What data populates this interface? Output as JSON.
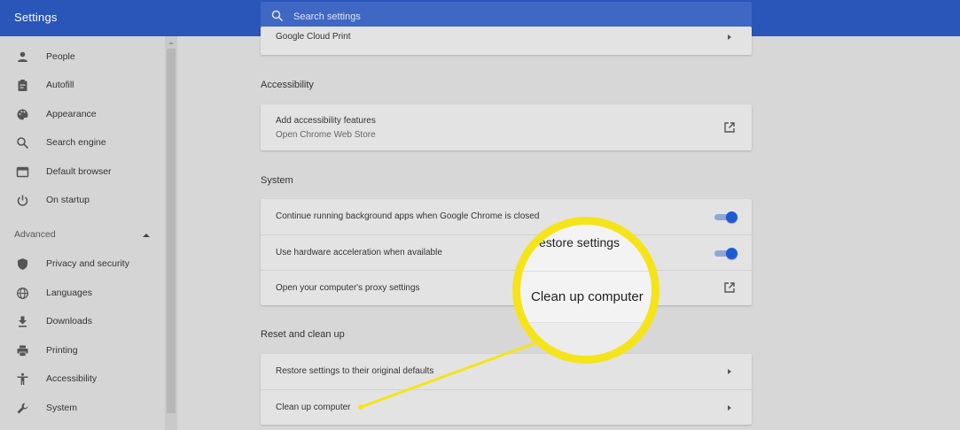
{
  "header": {
    "title": "Settings",
    "search_placeholder": "Search settings"
  },
  "sidebar": {
    "items": [
      {
        "label": "People",
        "icon": "person-icon"
      },
      {
        "label": "Autofill",
        "icon": "clipboard-icon"
      },
      {
        "label": "Appearance",
        "icon": "palette-icon"
      },
      {
        "label": "Search engine",
        "icon": "search-icon"
      },
      {
        "label": "Default browser",
        "icon": "browser-icon"
      },
      {
        "label": "On startup",
        "icon": "power-icon"
      }
    ],
    "advanced_label": "Advanced",
    "advanced_items": [
      {
        "label": "Privacy and security",
        "icon": "shield-icon"
      },
      {
        "label": "Languages",
        "icon": "globe-icon"
      },
      {
        "label": "Downloads",
        "icon": "download-icon"
      },
      {
        "label": "Printing",
        "icon": "printer-icon"
      },
      {
        "label": "Accessibility",
        "icon": "accessibility-icon"
      },
      {
        "label": "System",
        "icon": "wrench-icon"
      }
    ]
  },
  "main": {
    "google_cloud_print": "Google Cloud Print",
    "accessibility": {
      "title": "Accessibility",
      "row_label": "Add accessibility features",
      "row_sub": "Open Chrome Web Store"
    },
    "system": {
      "title": "System",
      "rows": [
        {
          "label": "Continue running background apps when Google Chrome is closed",
          "enabled": true
        },
        {
          "label": "Use hardware acceleration when available",
          "enabled": true
        },
        {
          "label": "Open your computer's proxy settings"
        }
      ]
    },
    "reset": {
      "title": "Reset and clean up",
      "rows": [
        {
          "label": "Restore settings to their original defaults"
        },
        {
          "label": "Clean up computer"
        }
      ]
    }
  },
  "magnifier": {
    "top_text": "estore settings",
    "bottom_text": "Clean up computer"
  },
  "colors": {
    "header": "#2a55b9",
    "toggle_on": "#1f5ad6",
    "highlight": "#f5e41a"
  }
}
